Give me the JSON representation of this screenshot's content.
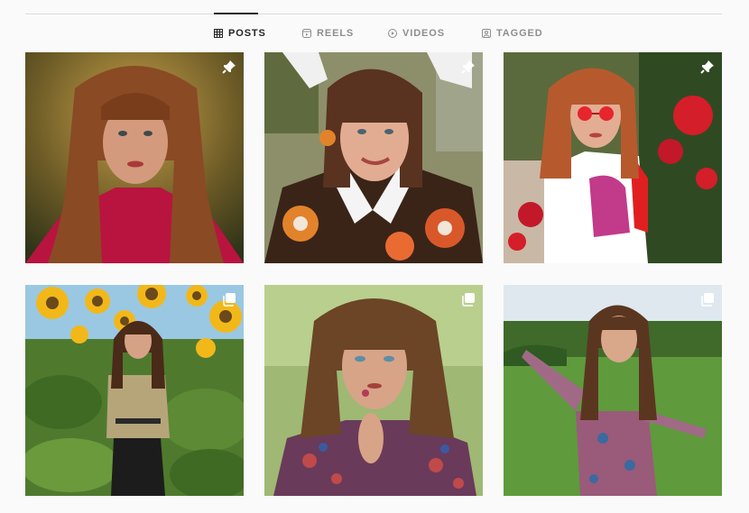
{
  "tabs": [
    {
      "label": "POSTS",
      "icon": "grid-icon",
      "active": true
    },
    {
      "label": "REELS",
      "icon": "reels-icon",
      "active": false
    },
    {
      "label": "VIDEOS",
      "icon": "play-icon",
      "active": false
    },
    {
      "label": "TAGGED",
      "icon": "tagged-icon",
      "active": false
    }
  ],
  "posts": [
    {
      "badge": "pin-icon"
    },
    {
      "badge": "pin-icon"
    },
    {
      "badge": "pin-icon"
    },
    {
      "badge": "multiple-photos-icon"
    },
    {
      "badge": "multiple-photos-icon"
    },
    {
      "badge": "multiple-photos-icon"
    }
  ],
  "colors": {
    "active_text": "#262626",
    "inactive_text": "#8e8e8e",
    "divider": "#dbdbdb",
    "background": "#fafafa"
  }
}
